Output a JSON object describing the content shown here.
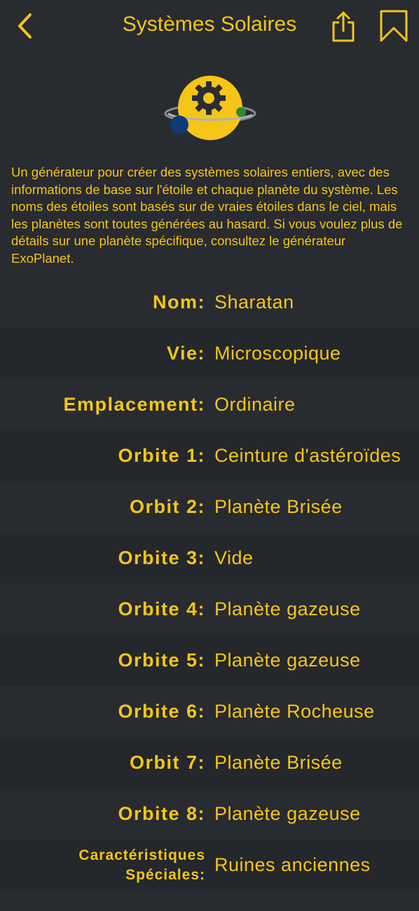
{
  "header": {
    "title": "Systèmes Solaires"
  },
  "description": "Un générateur pour créer des systèmes solaires entiers, avec des informations de base sur l'étoile et chaque planète du système. Les noms des étoiles sont basés sur de vraies étoiles dans le ciel, mais les planètes sont toutes générées au hasard. Si vous voulez plus de détails sur une planète spécifique, consultez le générateur ExoPlanet.",
  "rows": [
    {
      "label": "Nom:",
      "value": "Sharatan"
    },
    {
      "label": "Vie:",
      "value": "Microscopique"
    },
    {
      "label": "Emplacement:",
      "value": "Ordinaire"
    },
    {
      "label": "Orbite 1:",
      "value": "Ceinture d'astéroïdes"
    },
    {
      "label": "Orbit 2:",
      "value": "Planète Brisée"
    },
    {
      "label": "Orbite 3:",
      "value": "Vide"
    },
    {
      "label": "Orbite 4:",
      "value": "Planète gazeuse"
    },
    {
      "label": "Orbite 5:",
      "value": "Planète gazeuse"
    },
    {
      "label": "Orbite 6:",
      "value": "Planète Rocheuse"
    },
    {
      "label": "Orbit 7:",
      "value": "Planète Brisée"
    },
    {
      "label": "Orbite 8:",
      "value": "Planète gazeuse"
    },
    {
      "label_line1": "Caractéristiques",
      "label_line2": "Spéciales:",
      "value": "Ruines anciennes"
    }
  ],
  "icons": {
    "back": "chevron-left-icon",
    "share": "share-icon",
    "bookmark": "bookmark-icon",
    "logo": "solar-system-logo"
  },
  "colors": {
    "background": "#282b30",
    "row_alt": "#24272b",
    "accent": "#f5c518"
  }
}
